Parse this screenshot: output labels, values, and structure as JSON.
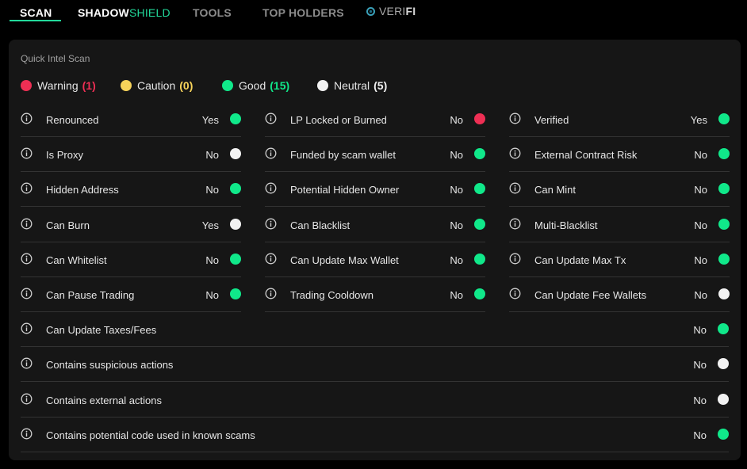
{
  "tabs": [
    {
      "label": "SCAN",
      "active": true
    },
    {
      "label_a": "SHADOW",
      "label_b": "SHIELD"
    },
    {
      "label": "TOOLS"
    },
    {
      "label": "TOP HOLDERS"
    },
    {
      "label_a": "VERI",
      "label_b": "FI",
      "icon": "verifi-logo-icon"
    }
  ],
  "panel": {
    "title": "Quick Intel Scan",
    "legend": [
      {
        "label": "Warning",
        "count": "(1)",
        "color": "#ee2f54"
      },
      {
        "label": "Caution",
        "count": "(0)",
        "color": "#f7d35a"
      },
      {
        "label": "Good",
        "count": "(15)",
        "color": "#10e88a"
      },
      {
        "label": "Neutral",
        "count": "(5)",
        "color": "#f2f2f2"
      }
    ],
    "grid": [
      [
        {
          "label": "Renounced",
          "value": "Yes",
          "status": "good"
        },
        {
          "label": "Is Proxy",
          "value": "No",
          "status": "neutral"
        },
        {
          "label": "Hidden Address",
          "value": "No",
          "status": "good"
        },
        {
          "label": "Can Burn",
          "value": "Yes",
          "status": "neutral"
        },
        {
          "label": "Can Whitelist",
          "value": "No",
          "status": "good"
        },
        {
          "label": "Can Pause Trading",
          "value": "No",
          "status": "good"
        }
      ],
      [
        {
          "label": "LP Locked or Burned",
          "value": "No",
          "status": "warning"
        },
        {
          "label": "Funded by scam wallet",
          "value": "No",
          "status": "good"
        },
        {
          "label": "Potential Hidden Owner",
          "value": "No",
          "status": "good"
        },
        {
          "label": "Can Blacklist",
          "value": "No",
          "status": "good"
        },
        {
          "label": "Can Update Max Wallet",
          "value": "No",
          "status": "good"
        },
        {
          "label": "Trading Cooldown",
          "value": "No",
          "status": "good"
        }
      ],
      [
        {
          "label": "Verified",
          "value": "Yes",
          "status": "good"
        },
        {
          "label": "External Contract Risk",
          "value": "No",
          "status": "good"
        },
        {
          "label": "Can Mint",
          "value": "No",
          "status": "good"
        },
        {
          "label": "Multi-Blacklist",
          "value": "No",
          "status": "good"
        },
        {
          "label": "Can Update Max Tx",
          "value": "No",
          "status": "good"
        },
        {
          "label": "Can Update Fee Wallets",
          "value": "No",
          "status": "neutral"
        }
      ]
    ],
    "full_rows": [
      {
        "label": "Can Update Taxes/Fees",
        "value": "No",
        "status": "good"
      },
      {
        "label": "Contains suspicious actions",
        "value": "No",
        "status": "neutral"
      },
      {
        "label": "Contains external actions",
        "value": "No",
        "status": "neutral"
      },
      {
        "label": "Contains potential code used in known scams",
        "value": "No",
        "status": "good"
      }
    ]
  }
}
